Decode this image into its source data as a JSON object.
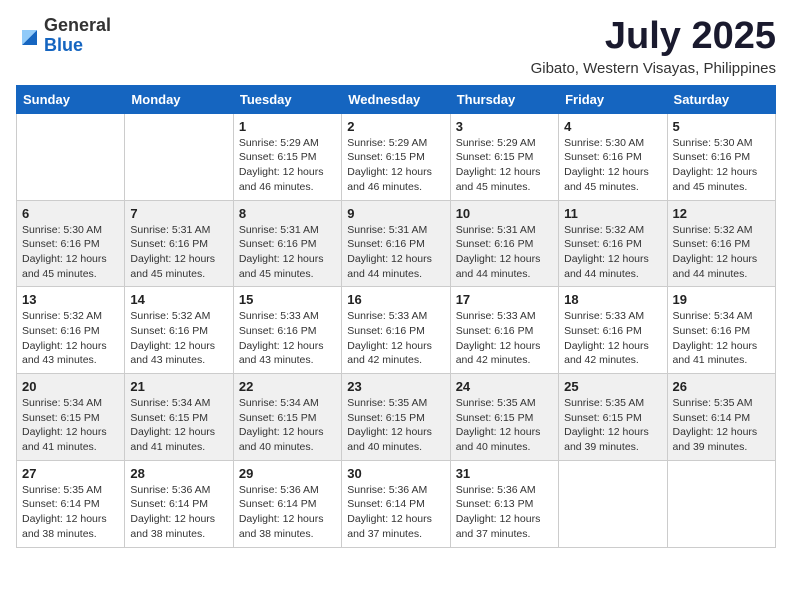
{
  "header": {
    "logo": {
      "text_general": "General",
      "text_blue": "Blue"
    },
    "title": "July 2025",
    "location": "Gibato, Western Visayas, Philippines"
  },
  "calendar": {
    "days_of_week": [
      "Sunday",
      "Monday",
      "Tuesday",
      "Wednesday",
      "Thursday",
      "Friday",
      "Saturday"
    ],
    "weeks": [
      {
        "row_bg": "white",
        "days": [
          {
            "date": "",
            "info": ""
          },
          {
            "date": "",
            "info": ""
          },
          {
            "date": "1",
            "info": "Sunrise: 5:29 AM\nSunset: 6:15 PM\nDaylight: 12 hours and 46 minutes."
          },
          {
            "date": "2",
            "info": "Sunrise: 5:29 AM\nSunset: 6:15 PM\nDaylight: 12 hours and 46 minutes."
          },
          {
            "date": "3",
            "info": "Sunrise: 5:29 AM\nSunset: 6:15 PM\nDaylight: 12 hours and 45 minutes."
          },
          {
            "date": "4",
            "info": "Sunrise: 5:30 AM\nSunset: 6:16 PM\nDaylight: 12 hours and 45 minutes."
          },
          {
            "date": "5",
            "info": "Sunrise: 5:30 AM\nSunset: 6:16 PM\nDaylight: 12 hours and 45 minutes."
          }
        ]
      },
      {
        "row_bg": "gray",
        "days": [
          {
            "date": "6",
            "info": "Sunrise: 5:30 AM\nSunset: 6:16 PM\nDaylight: 12 hours and 45 minutes."
          },
          {
            "date": "7",
            "info": "Sunrise: 5:31 AM\nSunset: 6:16 PM\nDaylight: 12 hours and 45 minutes."
          },
          {
            "date": "8",
            "info": "Sunrise: 5:31 AM\nSunset: 6:16 PM\nDaylight: 12 hours and 45 minutes."
          },
          {
            "date": "9",
            "info": "Sunrise: 5:31 AM\nSunset: 6:16 PM\nDaylight: 12 hours and 44 minutes."
          },
          {
            "date": "10",
            "info": "Sunrise: 5:31 AM\nSunset: 6:16 PM\nDaylight: 12 hours and 44 minutes."
          },
          {
            "date": "11",
            "info": "Sunrise: 5:32 AM\nSunset: 6:16 PM\nDaylight: 12 hours and 44 minutes."
          },
          {
            "date": "12",
            "info": "Sunrise: 5:32 AM\nSunset: 6:16 PM\nDaylight: 12 hours and 44 minutes."
          }
        ]
      },
      {
        "row_bg": "white",
        "days": [
          {
            "date": "13",
            "info": "Sunrise: 5:32 AM\nSunset: 6:16 PM\nDaylight: 12 hours and 43 minutes."
          },
          {
            "date": "14",
            "info": "Sunrise: 5:32 AM\nSunset: 6:16 PM\nDaylight: 12 hours and 43 minutes."
          },
          {
            "date": "15",
            "info": "Sunrise: 5:33 AM\nSunset: 6:16 PM\nDaylight: 12 hours and 43 minutes."
          },
          {
            "date": "16",
            "info": "Sunrise: 5:33 AM\nSunset: 6:16 PM\nDaylight: 12 hours and 42 minutes."
          },
          {
            "date": "17",
            "info": "Sunrise: 5:33 AM\nSunset: 6:16 PM\nDaylight: 12 hours and 42 minutes."
          },
          {
            "date": "18",
            "info": "Sunrise: 5:33 AM\nSunset: 6:16 PM\nDaylight: 12 hours and 42 minutes."
          },
          {
            "date": "19",
            "info": "Sunrise: 5:34 AM\nSunset: 6:16 PM\nDaylight: 12 hours and 41 minutes."
          }
        ]
      },
      {
        "row_bg": "gray",
        "days": [
          {
            "date": "20",
            "info": "Sunrise: 5:34 AM\nSunset: 6:15 PM\nDaylight: 12 hours and 41 minutes."
          },
          {
            "date": "21",
            "info": "Sunrise: 5:34 AM\nSunset: 6:15 PM\nDaylight: 12 hours and 41 minutes."
          },
          {
            "date": "22",
            "info": "Sunrise: 5:34 AM\nSunset: 6:15 PM\nDaylight: 12 hours and 40 minutes."
          },
          {
            "date": "23",
            "info": "Sunrise: 5:35 AM\nSunset: 6:15 PM\nDaylight: 12 hours and 40 minutes."
          },
          {
            "date": "24",
            "info": "Sunrise: 5:35 AM\nSunset: 6:15 PM\nDaylight: 12 hours and 40 minutes."
          },
          {
            "date": "25",
            "info": "Sunrise: 5:35 AM\nSunset: 6:15 PM\nDaylight: 12 hours and 39 minutes."
          },
          {
            "date": "26",
            "info": "Sunrise: 5:35 AM\nSunset: 6:14 PM\nDaylight: 12 hours and 39 minutes."
          }
        ]
      },
      {
        "row_bg": "white",
        "days": [
          {
            "date": "27",
            "info": "Sunrise: 5:35 AM\nSunset: 6:14 PM\nDaylight: 12 hours and 38 minutes."
          },
          {
            "date": "28",
            "info": "Sunrise: 5:36 AM\nSunset: 6:14 PM\nDaylight: 12 hours and 38 minutes."
          },
          {
            "date": "29",
            "info": "Sunrise: 5:36 AM\nSunset: 6:14 PM\nDaylight: 12 hours and 38 minutes."
          },
          {
            "date": "30",
            "info": "Sunrise: 5:36 AM\nSunset: 6:14 PM\nDaylight: 12 hours and 37 minutes."
          },
          {
            "date": "31",
            "info": "Sunrise: 5:36 AM\nSunset: 6:13 PM\nDaylight: 12 hours and 37 minutes."
          },
          {
            "date": "",
            "info": ""
          },
          {
            "date": "",
            "info": ""
          }
        ]
      }
    ]
  }
}
